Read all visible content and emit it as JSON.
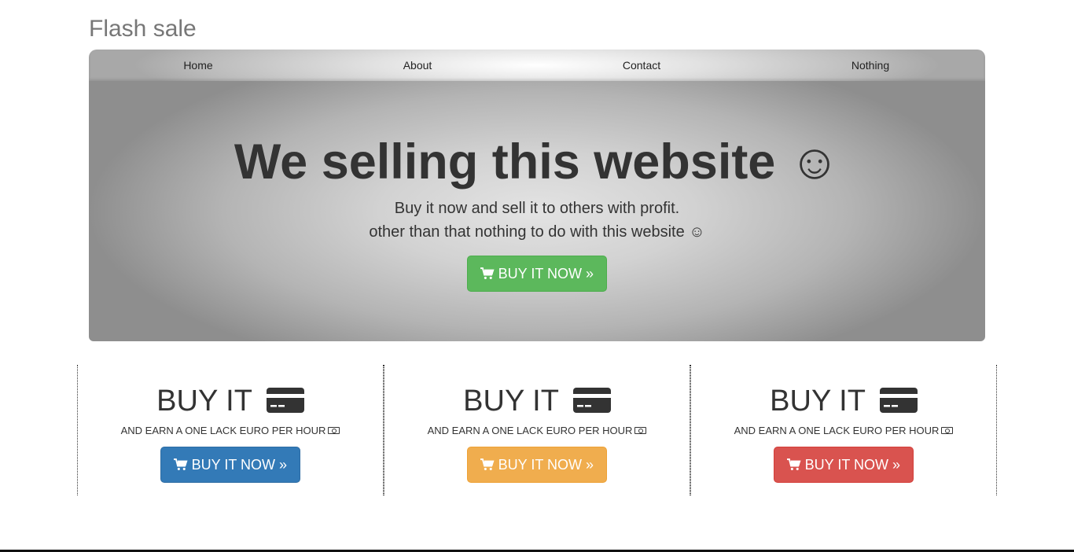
{
  "brand": "Flash sale",
  "nav": {
    "items": [
      {
        "label": "Home"
      },
      {
        "label": "About"
      },
      {
        "label": "Contact"
      },
      {
        "label": "Nothing"
      }
    ]
  },
  "hero": {
    "title": "We selling this website ☺",
    "line1": "Buy it now and sell it to others with profit.",
    "line2": "other than that nothing to do with this website ☺",
    "button_label": "BUY IT NOW »",
    "button_color": "#5cb85c"
  },
  "columns": [
    {
      "title": "BUY IT",
      "subtitle": "AND EARN A ONE LACK EURO PER HOUR",
      "button_label": "BUY IT NOW »",
      "button_color": "#337ab7"
    },
    {
      "title": "BUY IT",
      "subtitle": "AND EARN A ONE LACK EURO PER HOUR",
      "button_label": "BUY IT NOW »",
      "button_color": "#f0ad4e"
    },
    {
      "title": "BUY IT",
      "subtitle": "AND EARN A ONE LACK EURO PER HOUR",
      "button_label": "BUY IT NOW »",
      "button_color": "#d9534f"
    }
  ],
  "icons": {
    "cart": "shopping-cart-icon",
    "card": "credit-card-icon",
    "money": "money-bill-icon"
  }
}
